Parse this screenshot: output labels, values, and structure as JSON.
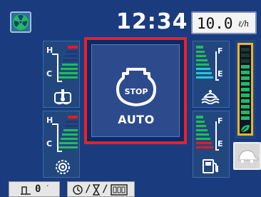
{
  "header": {
    "clock": "12:34",
    "fuel_rate": {
      "value": "10.0",
      "unit": "ℓ/h"
    }
  },
  "left_gauges": {
    "coolant": {
      "high_label": "H",
      "low_label": "C",
      "icon": "engine-temperature-icon",
      "level": 0.45
    },
    "hydraulic_oil": {
      "high_label": "H",
      "low_label": "C",
      "icon": "hydraulic-oil-temperature-icon",
      "level": 0.45
    }
  },
  "right_gauges": {
    "fuel": {
      "full_label": "F",
      "empty_label": "E",
      "icon": "fuel-icon",
      "level": 0.75
    },
    "def": {
      "full_label": "F",
      "empty_label": "E",
      "icon": "def-adblue-icon",
      "level": 0.75
    }
  },
  "alert": {
    "icon": "engine-stop-icon",
    "icon_text": "STOP",
    "label": "AUTO",
    "border_color": "#ee1f25"
  },
  "eco_gauge": {
    "icon": "leaf-eco-icon",
    "level": 0.72,
    "accent": "#e7b722"
  },
  "buttons": {
    "fan": "fan-icon",
    "turtle": "turtle-slow-mode-icon"
  },
  "footer": {
    "odometer_value": "0",
    "hour_meter_icons": [
      "clock-icon",
      "hourglass-icon",
      "counter-icon"
    ]
  },
  "colors": {
    "background": "#1a3c7e",
    "gauge_green": "#1fbd5a",
    "gauge_red": "#e61c1c",
    "gauge_cyan": "#27c6d7"
  }
}
